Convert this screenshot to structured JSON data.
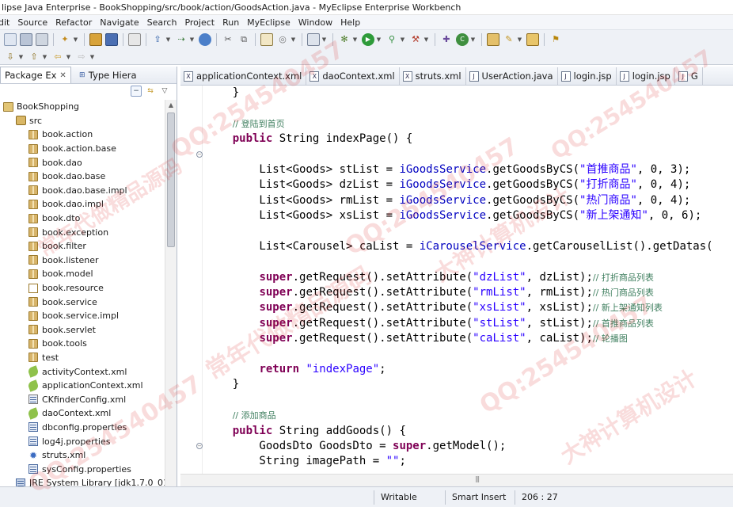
{
  "window": {
    "title": "lipse Java Enterprise - BookShopping/src/book/action/GoodsAction.java - MyEclipse Enterprise Workbench"
  },
  "menu": [
    "dit",
    "Source",
    "Refactor",
    "Navigate",
    "Search",
    "Project",
    "Run",
    "MyEclipse",
    "Window",
    "Help"
  ],
  "left_panel": {
    "tabs": [
      {
        "label": "Package Ex",
        "active": true
      },
      {
        "label": "Type Hiera",
        "active": false
      }
    ],
    "tree": [
      {
        "label": "BookShopping",
        "icon": "project-icon",
        "indent": 0
      },
      {
        "label": "src",
        "icon": "source-folder-icon",
        "indent": 1
      },
      {
        "label": "book.action",
        "icon": "package-icon",
        "indent": 2
      },
      {
        "label": "book.action.base",
        "icon": "package-icon",
        "indent": 2
      },
      {
        "label": "book.dao",
        "icon": "package-icon",
        "indent": 2
      },
      {
        "label": "book.dao.base",
        "icon": "package-icon",
        "indent": 2
      },
      {
        "label": "book.dao.base.impl",
        "icon": "package-icon",
        "indent": 2
      },
      {
        "label": "book.dao.impl",
        "icon": "package-icon",
        "indent": 2
      },
      {
        "label": "book.dto",
        "icon": "package-icon",
        "indent": 2
      },
      {
        "label": "book.exception",
        "icon": "package-icon",
        "indent": 2
      },
      {
        "label": "book.filter",
        "icon": "package-icon",
        "indent": 2
      },
      {
        "label": "book.listener",
        "icon": "package-icon",
        "indent": 2
      },
      {
        "label": "book.model",
        "icon": "package-icon",
        "indent": 2
      },
      {
        "label": "book.resource",
        "icon": "empty-package-icon",
        "indent": 2
      },
      {
        "label": "book.service",
        "icon": "package-icon",
        "indent": 2
      },
      {
        "label": "book.service.impl",
        "icon": "package-icon",
        "indent": 2
      },
      {
        "label": "book.servlet",
        "icon": "package-icon",
        "indent": 2
      },
      {
        "label": "book.tools",
        "icon": "package-icon",
        "indent": 2
      },
      {
        "label": "test",
        "icon": "package-icon",
        "indent": 2
      },
      {
        "label": "activityContext.xml",
        "icon": "xml-file-icon",
        "indent": 2
      },
      {
        "label": "applicationContext.xml",
        "icon": "xml-file-icon",
        "indent": 2
      },
      {
        "label": "CKfinderConfig.xml",
        "icon": "xml-text-icon",
        "indent": 2
      },
      {
        "label": "daoContext.xml",
        "icon": "xml-file-icon",
        "indent": 2
      },
      {
        "label": "dbconfig.properties",
        "icon": "properties-icon",
        "indent": 2
      },
      {
        "label": "log4j.properties",
        "icon": "properties-icon",
        "indent": 2
      },
      {
        "label": "struts.xml",
        "icon": "gear-xml-icon",
        "indent": 2
      },
      {
        "label": "sysConfig.properties",
        "icon": "properties-icon",
        "indent": 2
      },
      {
        "label": "JRE System Library [jdk1.7.0_01]",
        "icon": "library-icon",
        "indent": 1
      }
    ]
  },
  "editor": {
    "tabs": [
      {
        "label": "applicationContext.xml",
        "icon": "X"
      },
      {
        "label": "daoContext.xml",
        "icon": "X"
      },
      {
        "label": "struts.xml",
        "icon": "X"
      },
      {
        "label": "UserAction.java",
        "icon": "J"
      },
      {
        "label": "login.jsp",
        "icon": "J"
      },
      {
        "label": "login.jsp",
        "icon": "J"
      },
      {
        "label": "G",
        "icon": "J"
      }
    ],
    "lines": [
      [
        {
          "t": "    }",
          "c": ""
        }
      ],
      [
        {
          "t": "",
          "c": ""
        }
      ],
      [
        {
          "t": "    ",
          "c": ""
        },
        {
          "t": "// 登陆到首页",
          "c": "com"
        }
      ],
      [
        {
          "t": "    ",
          "c": ""
        },
        {
          "t": "public",
          "c": "kw"
        },
        {
          "t": " String indexPage() {",
          "c": ""
        }
      ],
      [
        {
          "t": "",
          "c": ""
        }
      ],
      [
        {
          "t": "        List<Goods> stList = ",
          "c": ""
        },
        {
          "t": "iGoodsService",
          "c": "fld"
        },
        {
          "t": ".getGoodsByCS(",
          "c": ""
        },
        {
          "t": "\"首推商品\"",
          "c": "str"
        },
        {
          "t": ", 0, 3);",
          "c": ""
        }
      ],
      [
        {
          "t": "        List<Goods> dzList = ",
          "c": ""
        },
        {
          "t": "iGoodsService",
          "c": "fld"
        },
        {
          "t": ".getGoodsByCS(",
          "c": ""
        },
        {
          "t": "\"打折商品\"",
          "c": "str"
        },
        {
          "t": ", 0, 4);",
          "c": ""
        }
      ],
      [
        {
          "t": "        List<Goods> rmList = ",
          "c": ""
        },
        {
          "t": "iGoodsService",
          "c": "fld"
        },
        {
          "t": ".getGoodsByCS(",
          "c": ""
        },
        {
          "t": "\"热门商品\"",
          "c": "str"
        },
        {
          "t": ", 0, 4);",
          "c": ""
        }
      ],
      [
        {
          "t": "        List<Goods> xsList = ",
          "c": ""
        },
        {
          "t": "iGoodsService",
          "c": "fld"
        },
        {
          "t": ".getGoodsByCS(",
          "c": ""
        },
        {
          "t": "\"新上架通知\"",
          "c": "str"
        },
        {
          "t": ", 0, 6);",
          "c": ""
        }
      ],
      [
        {
          "t": "",
          "c": ""
        }
      ],
      [
        {
          "t": "        List<Carousel> caList = ",
          "c": ""
        },
        {
          "t": "iCarouselService",
          "c": "fld"
        },
        {
          "t": ".getCarouselList().getDatas(",
          "c": ""
        }
      ],
      [
        {
          "t": "",
          "c": ""
        }
      ],
      [
        {
          "t": "        ",
          "c": ""
        },
        {
          "t": "super",
          "c": "kw"
        },
        {
          "t": ".getRequest().setAttribute(",
          "c": ""
        },
        {
          "t": "\"dzList\"",
          "c": "str"
        },
        {
          "t": ", dzList);",
          "c": ""
        },
        {
          "t": "// 打折商品列表",
          "c": "com"
        }
      ],
      [
        {
          "t": "        ",
          "c": ""
        },
        {
          "t": "super",
          "c": "kw"
        },
        {
          "t": ".getRequest().setAttribute(",
          "c": ""
        },
        {
          "t": "\"rmList\"",
          "c": "str"
        },
        {
          "t": ", rmList);",
          "c": ""
        },
        {
          "t": "// 热门商品列表",
          "c": "com"
        }
      ],
      [
        {
          "t": "        ",
          "c": ""
        },
        {
          "t": "super",
          "c": "kw"
        },
        {
          "t": ".getRequest().setAttribute(",
          "c": ""
        },
        {
          "t": "\"xsList\"",
          "c": "str"
        },
        {
          "t": ", xsList);",
          "c": ""
        },
        {
          "t": "// 新上架通知列表",
          "c": "com"
        }
      ],
      [
        {
          "t": "        ",
          "c": ""
        },
        {
          "t": "super",
          "c": "kw"
        },
        {
          "t": ".getRequest().setAttribute(",
          "c": ""
        },
        {
          "t": "\"stList\"",
          "c": "str"
        },
        {
          "t": ", stList);",
          "c": ""
        },
        {
          "t": "// 首推商品列表",
          "c": "com"
        }
      ],
      [
        {
          "t": "        ",
          "c": ""
        },
        {
          "t": "super",
          "c": "kw"
        },
        {
          "t": ".getRequest().setAttribute(",
          "c": ""
        },
        {
          "t": "\"caList\"",
          "c": "str"
        },
        {
          "t": ", caList);",
          "c": ""
        },
        {
          "t": "// 轮播图",
          "c": "com"
        }
      ],
      [
        {
          "t": "",
          "c": ""
        }
      ],
      [
        {
          "t": "        ",
          "c": ""
        },
        {
          "t": "return",
          "c": "kw"
        },
        {
          "t": " ",
          "c": ""
        },
        {
          "t": "\"indexPage\"",
          "c": "str"
        },
        {
          "t": ";",
          "c": ""
        }
      ],
      [
        {
          "t": "    }",
          "c": ""
        }
      ],
      [
        {
          "t": "",
          "c": ""
        }
      ],
      [
        {
          "t": "    ",
          "c": ""
        },
        {
          "t": "// 添加商品",
          "c": "com"
        }
      ],
      [
        {
          "t": "    ",
          "c": ""
        },
        {
          "t": "public",
          "c": "kw"
        },
        {
          "t": " String addGoods() {",
          "c": ""
        }
      ],
      [
        {
          "t": "        GoodsDto GoodsDto = ",
          "c": ""
        },
        {
          "t": "super",
          "c": "kw"
        },
        {
          "t": ".getModel();",
          "c": ""
        }
      ],
      [
        {
          "t": "        String imagePath = ",
          "c": ""
        },
        {
          "t": "\"\"",
          "c": "str"
        },
        {
          "t": ";",
          "c": ""
        }
      ]
    ]
  },
  "status": {
    "mode": "Writable",
    "insert": "Smart Insert",
    "position": "206 : 27"
  },
  "watermarks": [
    "QQ:254540457",
    "常年代做精品源码",
    "大神计算机设计"
  ]
}
